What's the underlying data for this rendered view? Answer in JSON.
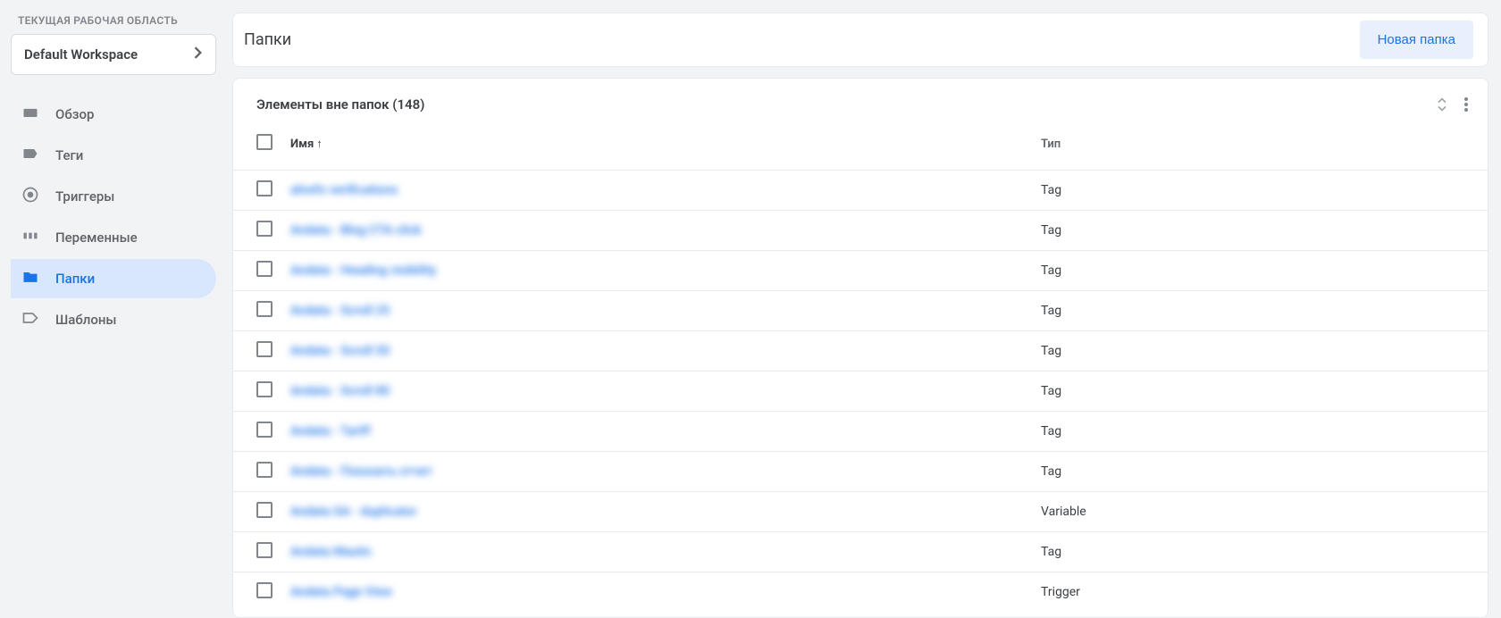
{
  "sidebar": {
    "workspace_label": "ТЕКУЩАЯ РАБОЧАЯ ОБЛАСТЬ",
    "workspace_name": "Default Workspace",
    "items": [
      {
        "label": "Обзор"
      },
      {
        "label": "Теги"
      },
      {
        "label": "Триггеры"
      },
      {
        "label": "Переменные"
      },
      {
        "label": "Папки"
      },
      {
        "label": "Шаблоны"
      }
    ]
  },
  "header": {
    "title": "Папки",
    "new_button": "Новая папка"
  },
  "section": {
    "title": "Элементы вне папок (148)"
  },
  "table": {
    "col_name": "Имя",
    "col_type": "Тип",
    "sort_indicator": "↑",
    "rows": [
      {
        "name": "ahrefs verifications",
        "type": "Tag"
      },
      {
        "name": "Andata - Blog CTA click",
        "type": "Tag"
      },
      {
        "name": "Andata - Heading visibility",
        "type": "Tag"
      },
      {
        "name": "Andata - Scroll 25",
        "type": "Tag"
      },
      {
        "name": "Andata - Scroll 50",
        "type": "Tag"
      },
      {
        "name": "Andata - Scroll 80",
        "type": "Tag"
      },
      {
        "name": "Andata - Tariff",
        "type": "Tag"
      },
      {
        "name": "Andata - Показать отчет",
        "type": "Tag"
      },
      {
        "name": "Andata GA - duplicator",
        "type": "Variable"
      },
      {
        "name": "Andata Mautic",
        "type": "Tag"
      },
      {
        "name": "Andata Page View",
        "type": "Trigger"
      }
    ]
  }
}
